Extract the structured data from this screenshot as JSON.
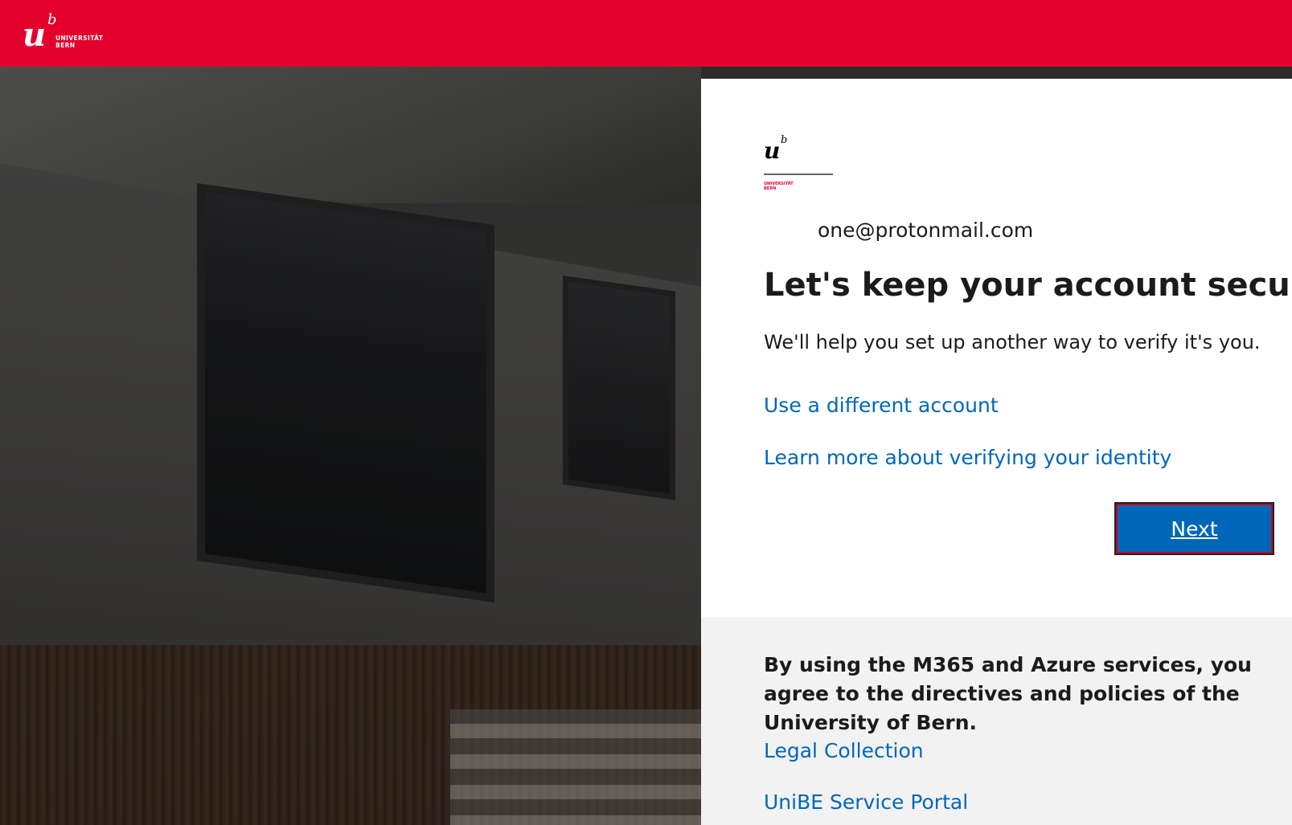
{
  "header": {
    "logo_letter": "u",
    "logo_super": "b",
    "logo_line1": "UNIVERSITÄT",
    "logo_line2": "BERN"
  },
  "signin": {
    "logo_letter": "u",
    "logo_super": "b",
    "logo_line1": "UNIVERSITÄT",
    "logo_line2": "BERN",
    "email": "one@protonmail.com",
    "title": "Let's keep your account secure",
    "description": "We'll help you set up another way to verify it's you.",
    "link_different_account": "Use a different account",
    "link_learn_more": "Learn more about verifying your identity",
    "next_label": "Next"
  },
  "footer": {
    "notice": "By using the M365 and Azure services, you agree to the directives and policies of the University of Bern.",
    "link_legal": "Legal Collection",
    "link_portal": "UniBE Service Portal"
  },
  "colors": {
    "brand_red": "#e3002d",
    "link_blue": "#0067b8",
    "button_blue": "#0067b8"
  }
}
